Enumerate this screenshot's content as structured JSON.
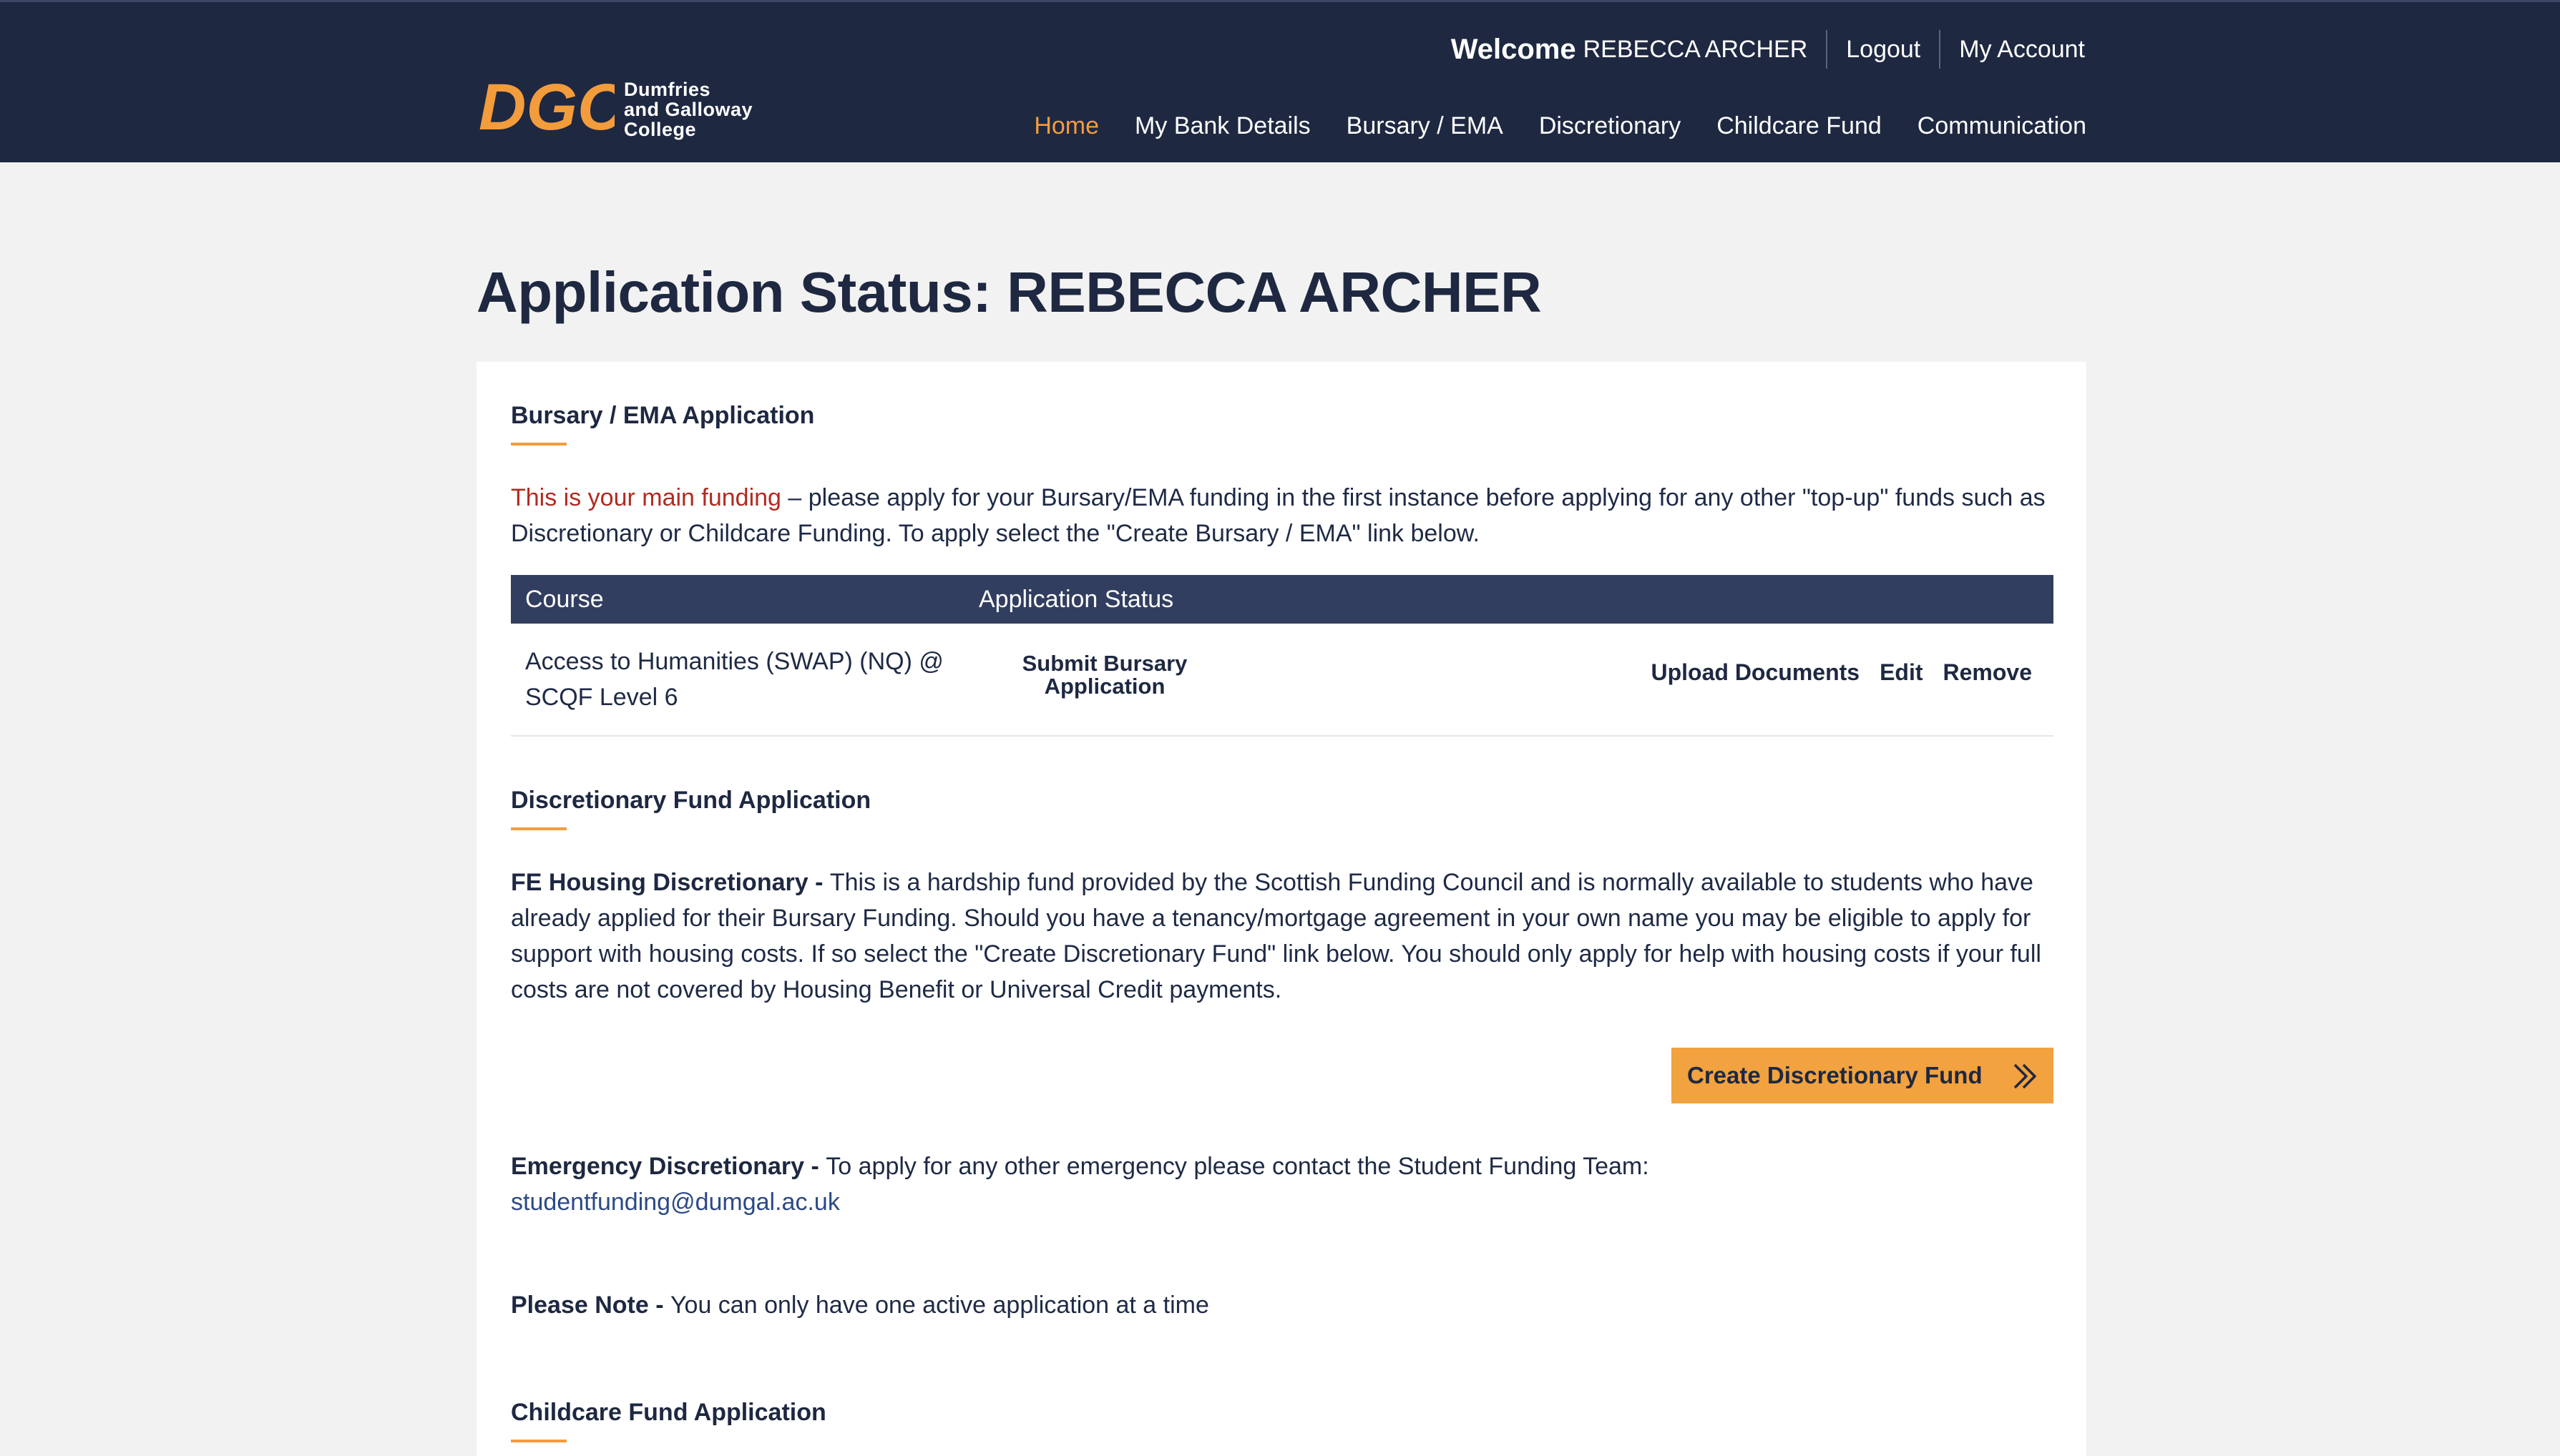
{
  "brand": {
    "logo_letters": "DGC",
    "line1": "Dumfries",
    "line2": "and Galloway",
    "line3": "College",
    "accent_color": "#f39c3c",
    "header_color": "#1e2841"
  },
  "topbar": {
    "welcome_word": "Welcome",
    "user_name": "REBECCA ARCHER",
    "logout": "Logout",
    "my_account": "My Account"
  },
  "nav": {
    "home": "Home",
    "bank": "My Bank Details",
    "bursary": "Bursary / EMA",
    "discretionary": "Discretionary",
    "childcare": "Childcare Fund",
    "communication": "Communication"
  },
  "page": {
    "title": "Application Status: REBECCA ARCHER"
  },
  "bursary": {
    "heading": "Bursary / EMA Application",
    "highlight": "This is your main funding",
    "intro_rest": " – please apply for your Bursary/EMA funding in the first instance before applying for any other \"top-up\" funds such as Discretionary or Childcare Funding. To apply select the \"Create Bursary / EMA\" link below.",
    "table": {
      "col_course": "Course",
      "col_status": "Application Status",
      "row": {
        "course": "Access to Humanities (SWAP) (NQ) @ SCQF Level 6",
        "status_link": "Submit Bursary Application",
        "upload": "Upload Documents",
        "edit": "Edit",
        "remove": "Remove"
      }
    }
  },
  "discretionary": {
    "heading": "Discretionary Fund Application",
    "fe_label": "FE Housing Discretionary - ",
    "fe_text": "This is a hardship fund provided by the Scottish Funding Council and is normally available to students who have already applied for their Bursary Funding. Should you have a tenancy/mortgage agreement in your own name you may be eligible to apply for support with housing costs. If so select the \"Create Discretionary Fund\" link below. You should only apply for help with housing costs if your full costs are not covered by Housing Benefit or Universal Credit payments.",
    "create_button": "Create Discretionary Fund",
    "emergency_label": "Emergency Discretionary - ",
    "emergency_text": "To apply for any other emergency please contact the Student Funding Team:",
    "email": "studentfunding@dumgal.ac.uk",
    "note_label": "Please Note - ",
    "note_text": "You can only have one active application at a time"
  },
  "childcare": {
    "heading": "Childcare Fund Application"
  }
}
